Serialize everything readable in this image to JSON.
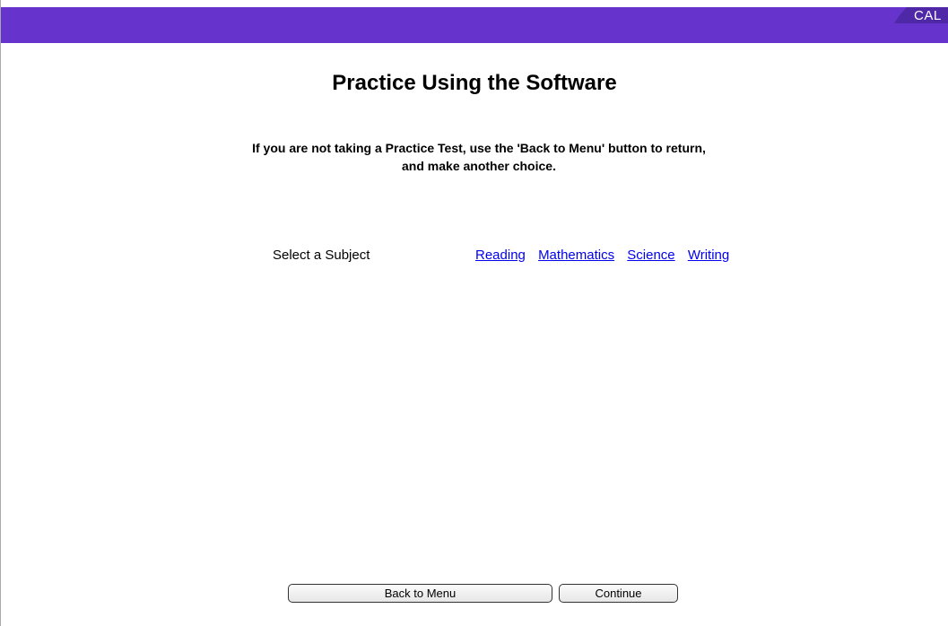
{
  "header": {
    "brand_text": "CAL",
    "bar_color": "#6633cc"
  },
  "main": {
    "title": "Practice Using the Software",
    "instruction_line1": "If you are not taking a Practice Test, use the 'Back to Menu' button to return,",
    "instruction_line2": "and make another choice.",
    "subject_label": "Select a Subject",
    "subjects": [
      "Reading",
      "Mathematics",
      "Science",
      "Writing"
    ]
  },
  "footer": {
    "back_label": "Back to Menu",
    "continue_label": "Continue"
  },
  "colors": {
    "link": "#0000ee",
    "accent": "#6633cc"
  }
}
